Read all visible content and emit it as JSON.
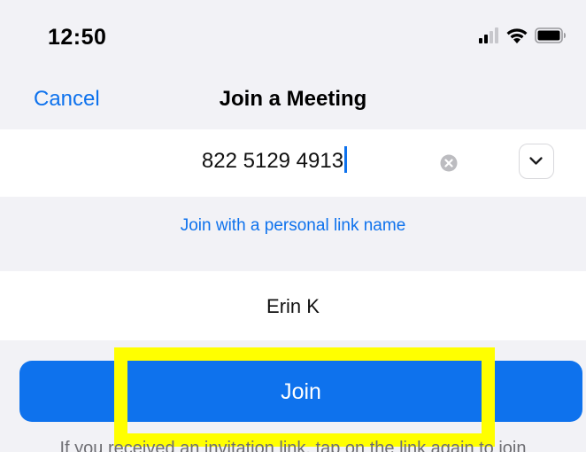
{
  "status_bar": {
    "time": "12:50"
  },
  "nav": {
    "cancel_label": "Cancel",
    "title": "Join a Meeting"
  },
  "meeting": {
    "id_value": "822 5129 4913"
  },
  "personal_link": {
    "label": "Join with a personal link name"
  },
  "name": {
    "value": "Erin K"
  },
  "join": {
    "label": "Join"
  },
  "hint": {
    "text": "If you received an invitation link, tap on the link again to join"
  },
  "icons": {
    "signal": "signal-icon",
    "wifi": "wifi-icon",
    "battery": "battery-icon",
    "clear": "clear-icon",
    "dropdown": "chevron-down-icon"
  },
  "colors": {
    "accent": "#0e72ed",
    "highlight": "#ffff00",
    "background": "#f2f2f6"
  }
}
